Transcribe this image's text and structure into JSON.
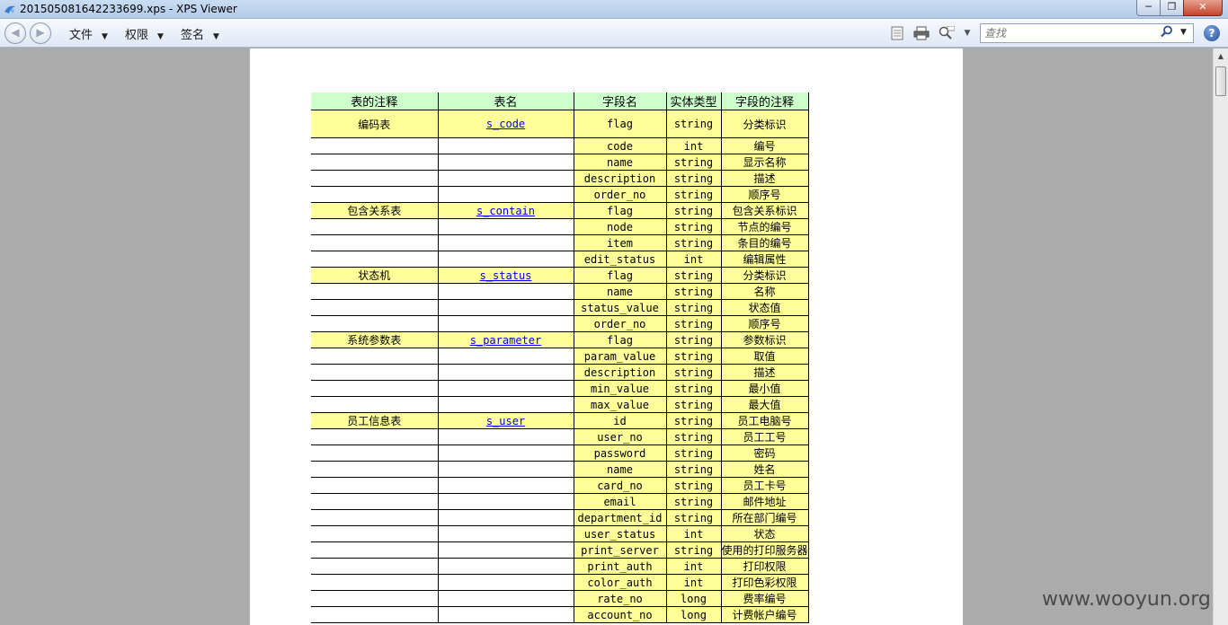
{
  "window": {
    "title": "201505081642233699.xps - XPS Viewer",
    "minimize_glyph": "─",
    "maximize_glyph": "❐",
    "close_glyph": "✕"
  },
  "toolbar": {
    "back_glyph": "◀",
    "forward_glyph": "▶",
    "menus": [
      "文件",
      "权限",
      "签名"
    ],
    "search_placeholder": "查找",
    "help_glyph": "?"
  },
  "table": {
    "headers": [
      "表的注释",
      "表名",
      "字段名",
      "实体类型",
      "字段的注释"
    ],
    "rows": [
      {
        "comment": "编码表",
        "table": "s_code",
        "field": "flag",
        "type": "string",
        "note": "分类标识"
      },
      {
        "comment": "",
        "table": "",
        "field": "code",
        "type": "int",
        "note": "编号"
      },
      {
        "comment": "",
        "table": "",
        "field": "name",
        "type": "string",
        "note": "显示名称"
      },
      {
        "comment": "",
        "table": "",
        "field": "description",
        "type": "string",
        "note": "描述"
      },
      {
        "comment": "",
        "table": "",
        "field": "order_no",
        "type": "string",
        "note": "顺序号"
      },
      {
        "comment": "包含关系表",
        "table": "s_contain",
        "field": "flag",
        "type": "string",
        "note": "包含关系标识"
      },
      {
        "comment": "",
        "table": "",
        "field": "node",
        "type": "string",
        "note": "节点的编号"
      },
      {
        "comment": "",
        "table": "",
        "field": "item",
        "type": "string",
        "note": "条目的编号"
      },
      {
        "comment": "",
        "table": "",
        "field": "edit_status",
        "type": "int",
        "note": "编辑属性"
      },
      {
        "comment": "状态机",
        "table": "s_status",
        "field": "flag",
        "type": "string",
        "note": "分类标识"
      },
      {
        "comment": "",
        "table": "",
        "field": "name",
        "type": "string",
        "note": "名称"
      },
      {
        "comment": "",
        "table": "",
        "field": "status_value",
        "type": "string",
        "note": "状态值"
      },
      {
        "comment": "",
        "table": "",
        "field": "order_no",
        "type": "string",
        "note": "顺序号"
      },
      {
        "comment": "系统参数表",
        "table": "s_parameter",
        "field": "flag",
        "type": "string",
        "note": "参数标识"
      },
      {
        "comment": "",
        "table": "",
        "field": "param_value",
        "type": "string",
        "note": "取值"
      },
      {
        "comment": "",
        "table": "",
        "field": "description",
        "type": "string",
        "note": "描述"
      },
      {
        "comment": "",
        "table": "",
        "field": "min_value",
        "type": "string",
        "note": "最小值"
      },
      {
        "comment": "",
        "table": "",
        "field": "max_value",
        "type": "string",
        "note": "最大值"
      },
      {
        "comment": "员工信息表",
        "table": "s_user",
        "field": "id",
        "type": "string",
        "note": "员工电脑号"
      },
      {
        "comment": "",
        "table": "",
        "field": "user_no",
        "type": "string",
        "note": "员工工号"
      },
      {
        "comment": "",
        "table": "",
        "field": "password",
        "type": "string",
        "note": "密码"
      },
      {
        "comment": "",
        "table": "",
        "field": "name",
        "type": "string",
        "note": "姓名"
      },
      {
        "comment": "",
        "table": "",
        "field": "card_no",
        "type": "string",
        "note": "员工卡号"
      },
      {
        "comment": "",
        "table": "",
        "field": "email",
        "type": "string",
        "note": "邮件地址"
      },
      {
        "comment": "",
        "table": "",
        "field": "department_id",
        "type": "string",
        "note": "所在部门编号"
      },
      {
        "comment": "",
        "table": "",
        "field": "user_status",
        "type": "int",
        "note": "状态"
      },
      {
        "comment": "",
        "table": "",
        "field": "print_server",
        "type": "string",
        "note": "使用的打印服务器"
      },
      {
        "comment": "",
        "table": "",
        "field": "print_auth",
        "type": "int",
        "note": "打印权限"
      },
      {
        "comment": "",
        "table": "",
        "field": "color_auth",
        "type": "int",
        "note": "打印色彩权限"
      },
      {
        "comment": "",
        "table": "",
        "field": "rate_no",
        "type": "long",
        "note": "费率编号"
      },
      {
        "comment": "",
        "table": "",
        "field": "account_no",
        "type": "long",
        "note": "计费帐户编号"
      }
    ]
  },
  "watermark": "www.wooyun.org"
}
